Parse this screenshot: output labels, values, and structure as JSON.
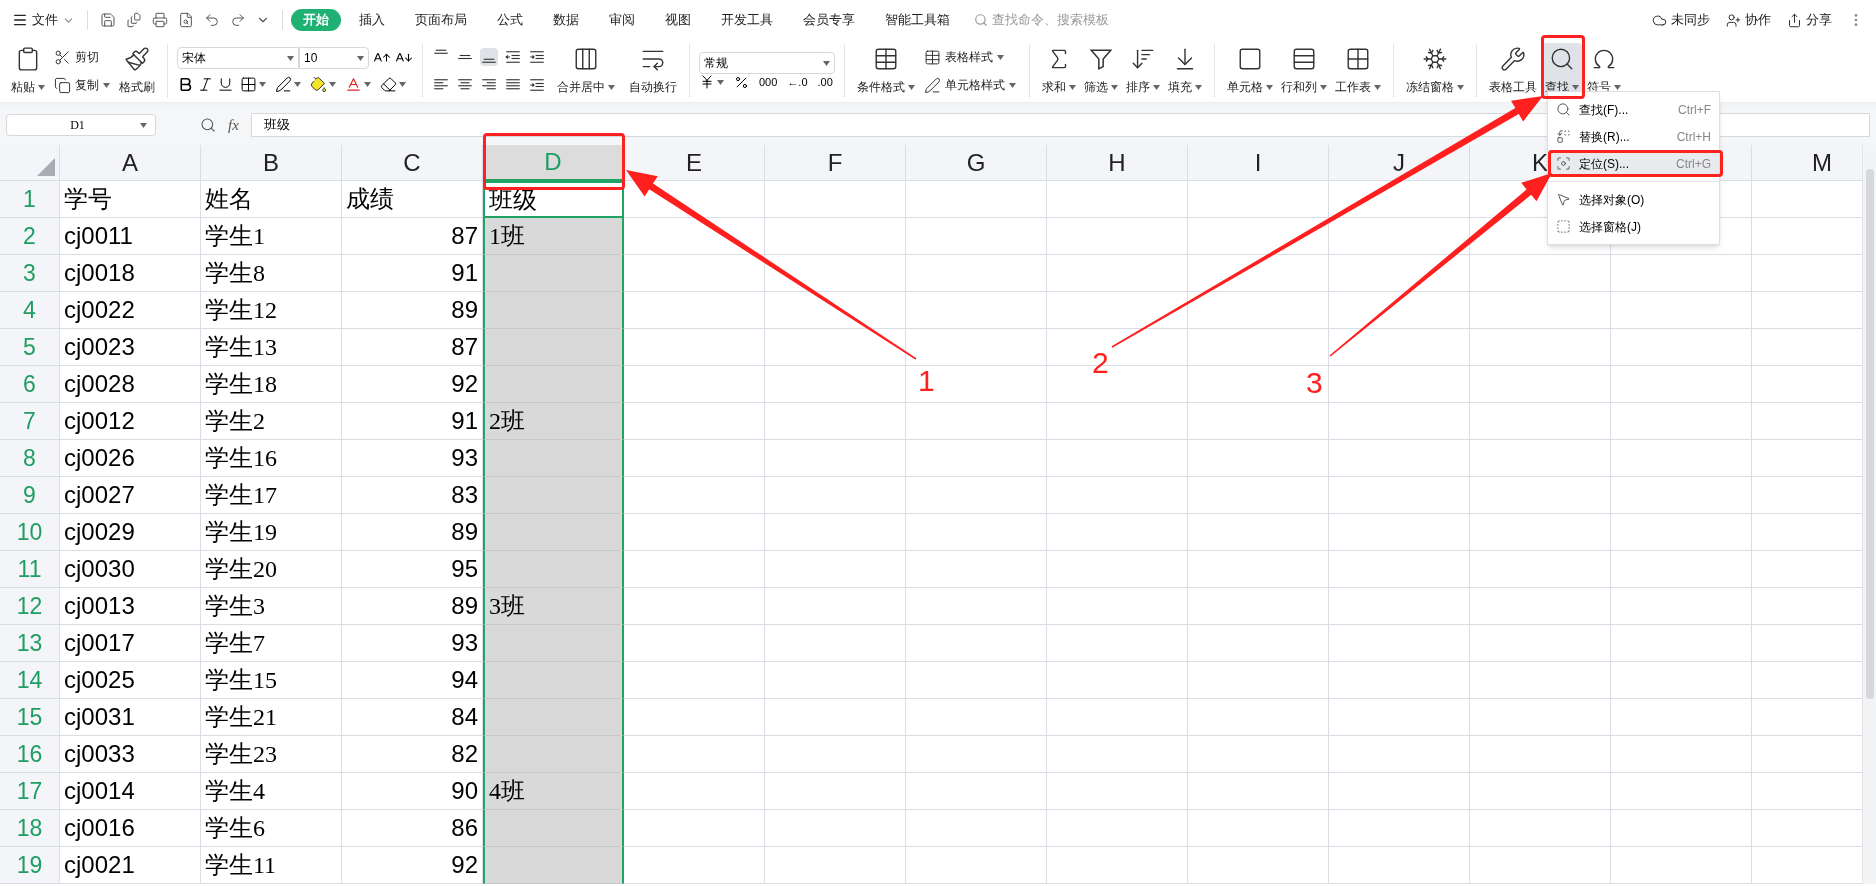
{
  "top_bar": {
    "file_menu": "文件",
    "tabs": [
      {
        "label": "开始",
        "selected": true
      },
      {
        "label": "插入",
        "selected": false
      },
      {
        "label": "页面布局",
        "selected": false
      },
      {
        "label": "公式",
        "selected": false
      },
      {
        "label": "数据",
        "selected": false
      },
      {
        "label": "审阅",
        "selected": false
      },
      {
        "label": "视图",
        "selected": false
      },
      {
        "label": "开发工具",
        "selected": false
      },
      {
        "label": "会员专享",
        "selected": false
      },
      {
        "label": "智能工具箱",
        "selected": false
      }
    ],
    "search": {
      "placeholder": "查找命令、搜索模板"
    },
    "actions": [
      "未同步",
      "协作",
      "分享"
    ]
  },
  "ribbon": {
    "groups": [
      {
        "kind": "buttons",
        "items": [
          {
            "kind": "large",
            "label": "粘贴",
            "dropdown": true
          },
          {
            "kind": "stack",
            "items": [
              {
                "label": "剪切",
                "dropdown": false
              },
              {
                "label": "复制",
                "dropdown": true
              }
            ]
          },
          {
            "kind": "large",
            "label": "格式刷",
            "dropdown": false
          }
        ]
      },
      {
        "kind": "font",
        "font_name": "宋体",
        "font_size": "10"
      },
      {
        "kind": "align",
        "items": [
          {
            "kind": "large",
            "label": "合并居中",
            "dropdown": true
          },
          {
            "kind": "large",
            "label": "自动换行",
            "dropdown": false
          }
        ]
      },
      {
        "kind": "number",
        "format": "常规",
        "thousands": "000",
        "increase_decimal": "←.0",
        "decrease_decimal": ".00"
      },
      {
        "kind": "buttons",
        "items": [
          {
            "kind": "large",
            "label": "条件格式",
            "dropdown": true
          },
          {
            "kind": "stack",
            "items": [
              {
                "label": "表格样式",
                "dropdown": true
              },
              {
                "label": "单元格样式",
                "dropdown": true
              }
            ]
          }
        ]
      },
      {
        "kind": "buttons",
        "items": [
          {
            "kind": "large",
            "label": "求和",
            "dropdown": true
          },
          {
            "kind": "large",
            "label": "筛选",
            "dropdown": true
          },
          {
            "kind": "large",
            "label": "排序",
            "dropdown": true
          },
          {
            "kind": "large",
            "label": "填充",
            "dropdown": true
          }
        ]
      },
      {
        "kind": "buttons",
        "items": [
          {
            "kind": "large",
            "label": "单元格",
            "dropdown": true
          },
          {
            "kind": "large",
            "label": "行和列",
            "dropdown": true
          },
          {
            "kind": "large",
            "label": "工作表",
            "dropdown": true
          }
        ]
      },
      {
        "kind": "buttons",
        "items": [
          {
            "kind": "large",
            "label": "冻结窗格",
            "dropdown": true
          }
        ]
      },
      {
        "kind": "buttons",
        "items": [
          {
            "kind": "large",
            "label": "表格工具",
            "dropdown": false,
            "pressed": false
          },
          {
            "kind": "large",
            "label": "查找",
            "dropdown": true,
            "pressed": true
          },
          {
            "kind": "large",
            "label": "符号",
            "dropdown": true,
            "pressed": false
          }
        ]
      }
    ]
  },
  "find_menu": {
    "sections": [
      [
        {
          "label": "查找(F)...",
          "shortcut": "Ctrl+F",
          "highlighted": false
        },
        {
          "label": "替换(R)...",
          "shortcut": "Ctrl+H",
          "highlighted": false
        },
        {
          "label": "定位(S)...",
          "shortcut": "Ctrl+G",
          "highlighted": true
        }
      ],
      [
        {
          "label": "选择对象(O)",
          "highlighted": false
        },
        {
          "label": "选择窗格(J)",
          "highlighted": false
        }
      ]
    ]
  },
  "formula_bar": {
    "name_box": "D1",
    "fx": "fx",
    "formula": "班级"
  },
  "sheet": {
    "columns": [
      {
        "label": "A",
        "selected": false
      },
      {
        "label": "B",
        "selected": false
      },
      {
        "label": "C",
        "selected": false
      },
      {
        "label": "D",
        "selected": true
      },
      {
        "label": "E",
        "selected": false
      },
      {
        "label": "F",
        "selected": false
      },
      {
        "label": "G",
        "selected": false
      },
      {
        "label": "H",
        "selected": false
      },
      {
        "label": "I",
        "selected": false
      },
      {
        "label": "J",
        "selected": false
      },
      {
        "label": "K",
        "selected": false
      },
      {
        "selected": false
      },
      {
        "label": "M",
        "selected": false
      }
    ],
    "rows": [
      {
        "label": "1",
        "active": true,
        "cells": [
          "学号",
          "姓名",
          "成绩",
          "班级"
        ]
      },
      {
        "label": "2",
        "active": false,
        "cells": [
          "cj0011",
          "学生1",
          "87",
          "1班"
        ]
      },
      {
        "label": "3",
        "active": false,
        "cells": [
          "cj0018",
          "学生8",
          "91"
        ]
      },
      {
        "label": "4",
        "active": false,
        "cells": [
          "cj0022",
          "学生12",
          "89"
        ]
      },
      {
        "label": "5",
        "active": false,
        "cells": [
          "cj0023",
          "学生13",
          "87"
        ]
      },
      {
        "label": "6",
        "active": false,
        "cells": [
          "cj0028",
          "学生18",
          "92"
        ]
      },
      {
        "label": "7",
        "active": false,
        "cells": [
          "cj0012",
          "学生2",
          "91",
          "2班"
        ]
      },
      {
        "label": "8",
        "active": false,
        "cells": [
          "cj0026",
          "学生16",
          "93"
        ]
      },
      {
        "label": "9",
        "active": false,
        "cells": [
          "cj0027",
          "学生17",
          "83"
        ]
      },
      {
        "label": "10",
        "active": false,
        "cells": [
          "cj0029",
          "学生19",
          "89"
        ]
      },
      {
        "label": "11",
        "active": false,
        "cells": [
          "cj0030",
          "学生20",
          "95"
        ]
      },
      {
        "label": "12",
        "active": false,
        "cells": [
          "cj0013",
          "学生3",
          "89",
          "3班"
        ]
      },
      {
        "label": "13",
        "active": false,
        "cells": [
          "cj0017",
          "学生7",
          "93"
        ]
      },
      {
        "label": "14",
        "active": false,
        "cells": [
          "cj0025",
          "学生15",
          "94"
        ]
      },
      {
        "label": "15",
        "active": false,
        "cells": [
          "cj0031",
          "学生21",
          "84"
        ]
      },
      {
        "label": "16",
        "active": false,
        "cells": [
          "cj0033",
          "学生23",
          "82"
        ]
      },
      {
        "label": "17",
        "active": false,
        "cells": [
          "cj0014",
          "学生4",
          "90",
          "4班"
        ]
      },
      {
        "label": "18",
        "active": false,
        "cells": [
          "cj0016",
          "学生6",
          "86"
        ]
      },
      {
        "label": "19",
        "active": false,
        "cells": [
          "cj0021",
          "学生11",
          "92"
        ]
      }
    ]
  },
  "annotations": {
    "callouts": [
      {
        "label": "1"
      },
      {
        "label": "2"
      },
      {
        "label": "3"
      }
    ]
  }
}
